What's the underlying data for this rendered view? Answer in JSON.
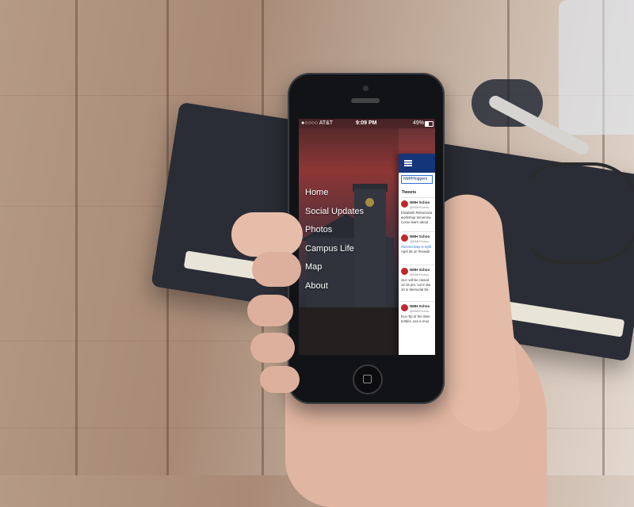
{
  "status_bar": {
    "carrier": "●○○○○ AT&T",
    "time": "9:09 PM",
    "battery": "49%",
    "battery_level": 0.49
  },
  "menu": {
    "items": [
      {
        "label": "Home"
      },
      {
        "label": "Social Updates"
      },
      {
        "label": "Photos"
      },
      {
        "label": "Campus Life"
      },
      {
        "label": "Map"
      },
      {
        "label": "About"
      }
    ]
  },
  "panel": {
    "search_chip": "NMHHoggers",
    "tweets_label": "Tweets",
    "tweets": [
      {
        "name": "NMH Schoo",
        "handle": "@NMHSchoo",
        "lines": [
          "Elizabeth Rebonioza",
          "workshop tomorrow",
          "Come learn about"
        ]
      },
      {
        "name": "NMH Schoo",
        "handle": "@NMHSchoo",
        "lines": [
          "#ServiceDay is right",
          "April 28 on #newsb"
        ]
      },
      {
        "name": "NMH Schoo",
        "handle": "@NMHSchoo",
        "lines": [
          "SLC will be closed",
          "12:15 pm, 1st in Ba",
          "16 in Memorial Dir"
        ]
      },
      {
        "name": "NMH Schoo",
        "handle": "@NMHSchoo",
        "lines": [
          "Eco-Tip of the Wee",
          "bottles, use a reus"
        ]
      }
    ]
  },
  "colors": {
    "panel_header": "#15357a",
    "avatar": "#c0282a",
    "link": "#2a73d6"
  },
  "icons": [
    "hamburger-icon",
    "battery-icon",
    "home-button-icon"
  ]
}
